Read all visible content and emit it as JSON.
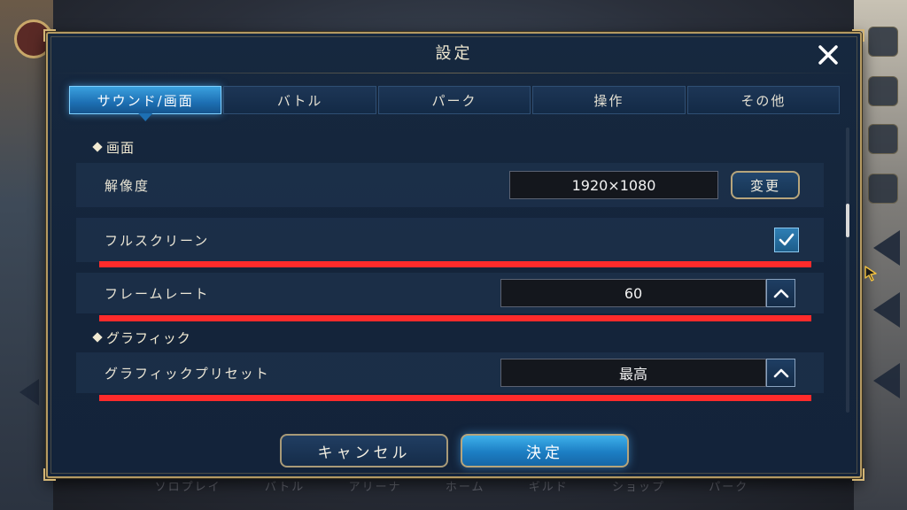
{
  "background": {
    "nav_items": [
      "ソロプレイ",
      "バトル",
      "アリーナ",
      "ホーム",
      "ギルド",
      "ショップ",
      "パーク"
    ]
  },
  "dialog": {
    "title": "設定",
    "close_icon": "close-icon"
  },
  "tabs": [
    {
      "label": "サウンド/画面",
      "active": true
    },
    {
      "label": "バトル",
      "active": false
    },
    {
      "label": "パーク",
      "active": false
    },
    {
      "label": "操作",
      "active": false
    },
    {
      "label": "その他",
      "active": false
    }
  ],
  "sections": {
    "screen": {
      "header": "画面",
      "resolution": {
        "label": "解像度",
        "value": "1920×1080",
        "change_label": "変更"
      },
      "fullscreen": {
        "label": "フルスクリーン",
        "checked": true
      },
      "framerate": {
        "label": "フレームレート",
        "value": "60"
      }
    },
    "graphics": {
      "header": "グラフィック",
      "preset": {
        "label": "グラフィックプリセット",
        "value": "最高"
      }
    }
  },
  "footer": {
    "cancel_label": "キャンセル",
    "ok_label": "決定"
  },
  "colors": {
    "accent_active_tab": "#1d6fb3",
    "highlight_line": "#ff2b2b",
    "frame_gold": "#b59a62"
  }
}
